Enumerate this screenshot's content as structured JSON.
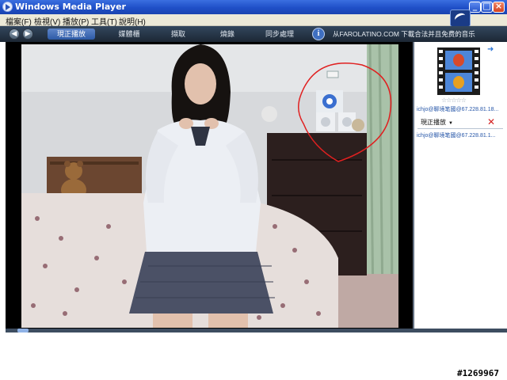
{
  "window": {
    "title": "Windows Media Player"
  },
  "window_controls": {
    "minimize": "_",
    "maximize": "□",
    "close": "×"
  },
  "menu": {
    "items": [
      {
        "label": "檔案(F)"
      },
      {
        "label": "檢視(V)"
      },
      {
        "label": "播放(P)"
      },
      {
        "label": "工具(T)"
      },
      {
        "label": "說明(H)"
      }
    ]
  },
  "nav": {
    "back_glyph": "◀",
    "forward_glyph": "▶",
    "tabs": [
      {
        "label": "現正播放",
        "active": true
      },
      {
        "label": "媒體櫃",
        "active": false
      },
      {
        "label": "擷取",
        "active": false
      },
      {
        "label": "燒錄",
        "active": false
      },
      {
        "label": "同步處理",
        "active": false
      }
    ],
    "info_glyph": "i",
    "promo_text": "从FAROLATINO.COM 下載合法并且免费的音乐"
  },
  "side_panel": {
    "arrow_glyph": "➜",
    "rating_stars": "☆☆☆☆☆",
    "media_title": "ichjo@聊境笔國@67.228.81.18...",
    "now_playing_label": "現正播放",
    "now_playing_chevron": "▼",
    "close_glyph": "✕",
    "playlist": [
      {
        "label": "ichjo@聊境笔國@67.228.81.1..."
      }
    ]
  },
  "watermark": "#1269967",
  "colors": {
    "titlebar": "#1f4fc7",
    "navbar": "#1c2734",
    "accent_tab": "#2d5aa6",
    "annotation_circle": "#e02020"
  },
  "icons": {
    "app": "media-player-icon",
    "back": "back-arrow-icon",
    "forward": "forward-arrow-icon",
    "info": "info-icon",
    "close": "close-icon",
    "album": "film-strip-icon"
  }
}
